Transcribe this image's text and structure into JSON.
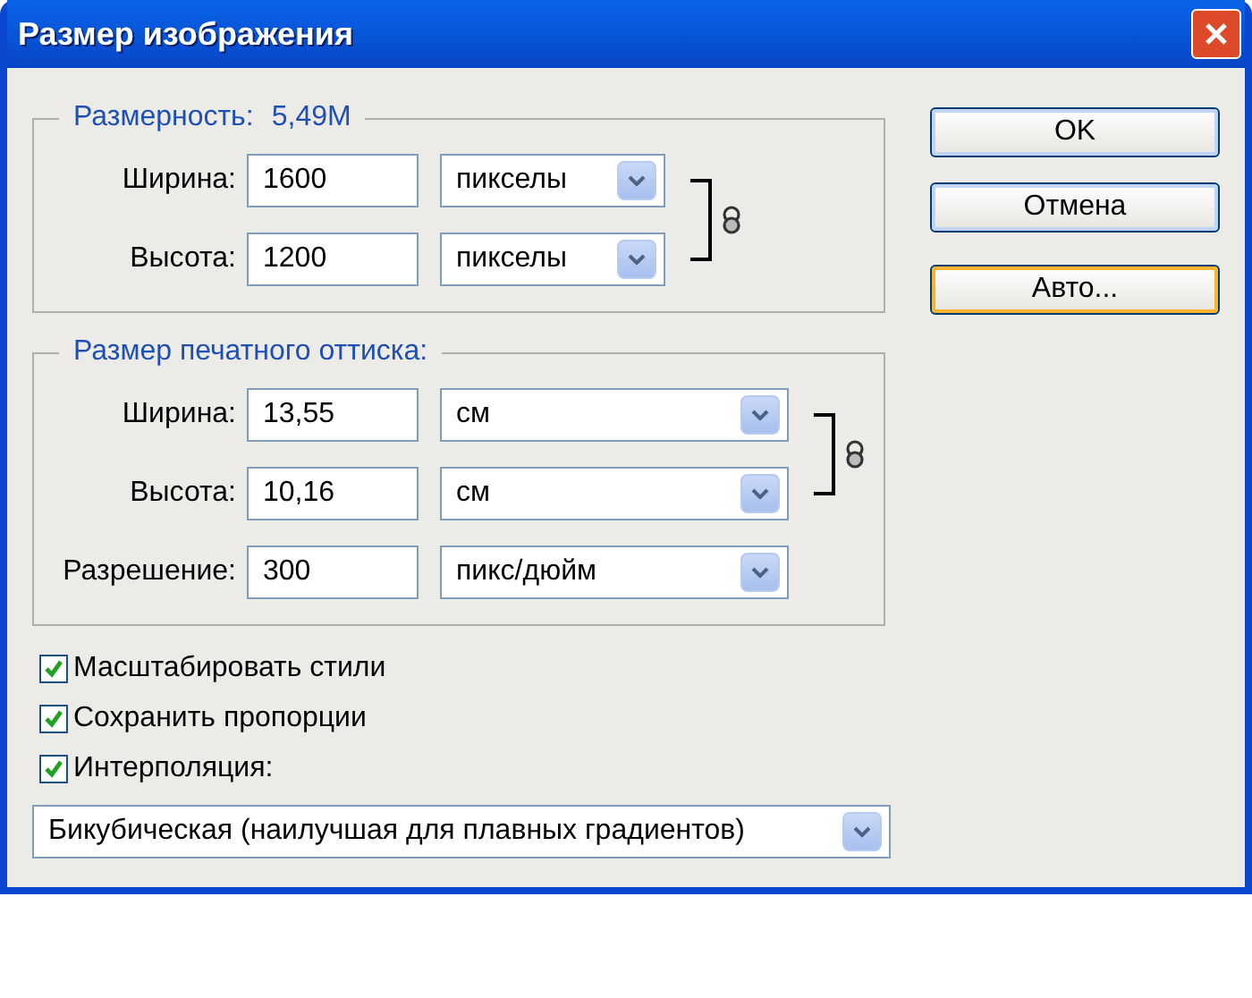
{
  "window": {
    "title": "Размер изображения"
  },
  "pixel_dimensions": {
    "title": "Размерность:",
    "value": "5,49M",
    "constrained": true,
    "rows": [
      {
        "label": "Ширина:",
        "value": "1600",
        "unit": "пикселы"
      },
      {
        "label": "Высота:",
        "value": "1200",
        "unit": "пикселы"
      }
    ]
  },
  "document_size": {
    "title": "Размер печатного оттиска:",
    "constrained": true,
    "rows": [
      {
        "label": "Ширина:",
        "value": "13,55",
        "unit": "см"
      },
      {
        "label": "Высота:",
        "value": "10,16",
        "unit": "см"
      },
      {
        "label": "Разрешение:",
        "value": "300",
        "unit": "пикс/дюйм"
      }
    ]
  },
  "checkboxes": [
    {
      "label": "Масштабировать стили",
      "checked": true
    },
    {
      "label": "Сохранить пропорции",
      "checked": true
    },
    {
      "label": "Интерполяция:",
      "checked": true
    }
  ],
  "interpolation": {
    "value": "Бикубическая (наилучшая для плавных градиентов)"
  },
  "buttons": [
    {
      "label": "OK",
      "focused": false
    },
    {
      "label": "Отмена",
      "focused": false
    },
    {
      "label": "Авто...",
      "focused": true
    }
  ]
}
